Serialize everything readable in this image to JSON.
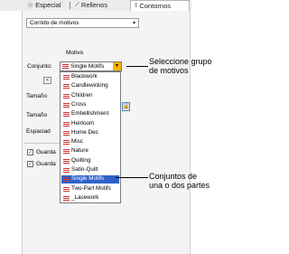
{
  "tabs": [
    {
      "icon": "star-icon",
      "label": "Especial"
    },
    {
      "icon": "fill-icon",
      "label": "Rellenos"
    },
    {
      "icon": "contour-icon",
      "label": "Contornos"
    }
  ],
  "panel": {
    "stitch_type": "Corrido de motivos",
    "section_title": "Motivo",
    "set_label": "Conjunto:",
    "set_value": "Single Motifs",
    "prev_button": "<",
    "size_label_1": "Tamaño",
    "size_label_2": "Tamaño",
    "spacing_label": "Espaciad",
    "check_1_label": "Guarda",
    "check_2_label": "Guarda"
  },
  "motif_sets": [
    "Blackwork",
    "Candlewicking",
    "Children",
    "Cross",
    "Embellishment",
    "Heirloom",
    "Home Dec",
    "Misc",
    "Nature",
    "Quilting",
    "Satin-Quilt",
    "Single Motifs",
    "Two-Part Motifs",
    "_Lacework"
  ],
  "selected_index": 11,
  "annotations": {
    "select_group_line1": "Seleccione grupo",
    "select_group_line2": "de motivos",
    "sets_line1": "Conjuntos de",
    "sets_line2": "una o dos partes"
  },
  "colors": {
    "selection": "#2f62c8",
    "dropdown_button": "#f3b400",
    "motif_icon": "#d32f2f"
  }
}
